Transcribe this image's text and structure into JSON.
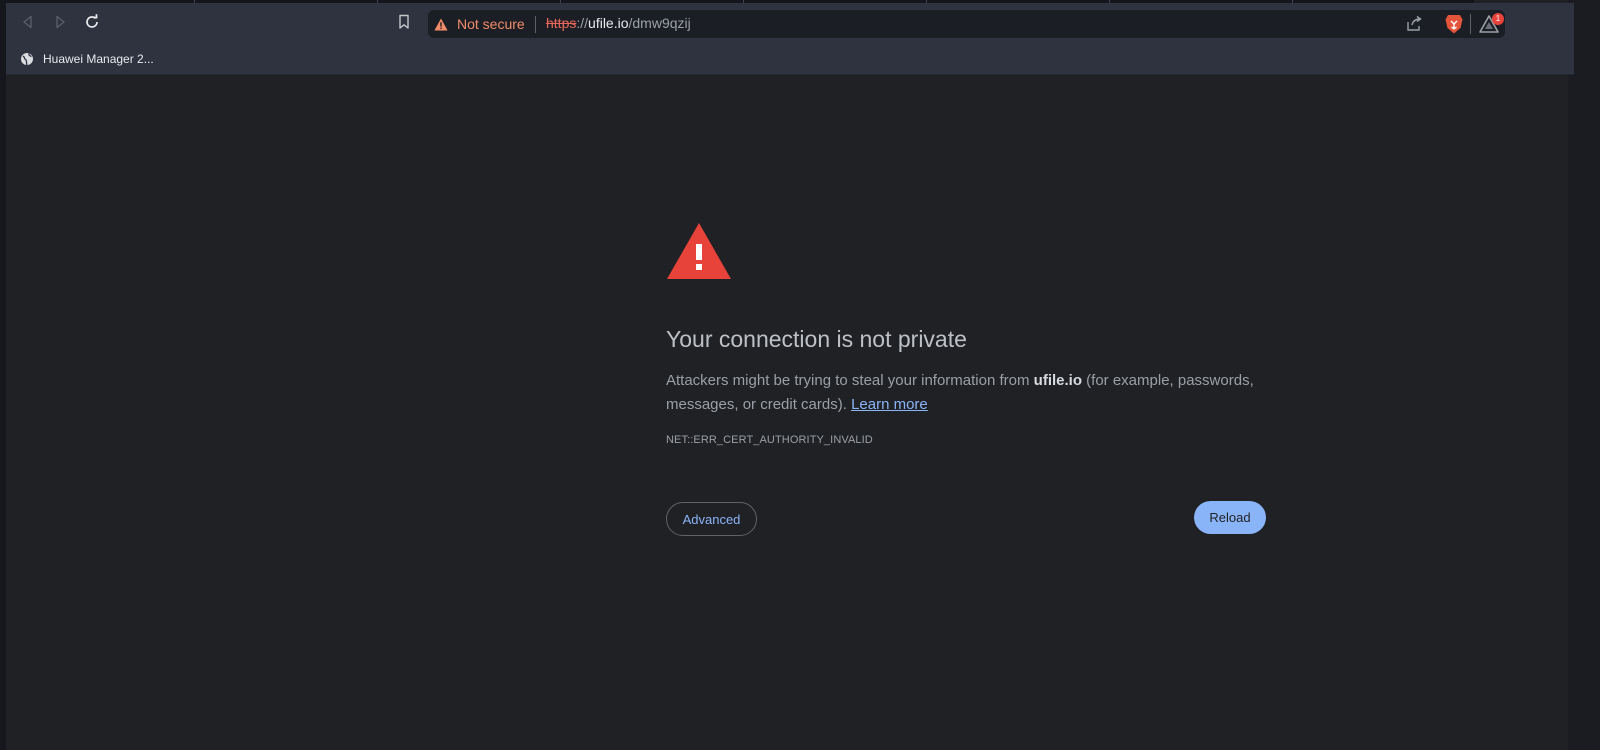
{
  "browser": {
    "omnibox": {
      "security_label": "Not secure",
      "url_scheme": "https",
      "url_sep": "://",
      "url_host": "ufile.io",
      "url_path": "/dmw9qzij"
    },
    "rewards_badge_count": "1",
    "bookmarks": [
      {
        "label": "Huawei Manager 2..."
      }
    ],
    "colors": {
      "not_secure": "#f28b68",
      "warning_triangle": "#e8433b",
      "link": "#8ab4f8"
    }
  },
  "page": {
    "heading": "Your connection is not private",
    "description_prefix": "Attackers might be trying to steal your information from ",
    "description_host": "ufile.io",
    "description_suffix": " (for example, passwords, messages, or credit cards). ",
    "learn_more_link": "Learn more",
    "error_code": "NET::ERR_CERT_AUTHORITY_INVALID",
    "advanced_button": "Advanced",
    "reload_button": "Reload"
  }
}
